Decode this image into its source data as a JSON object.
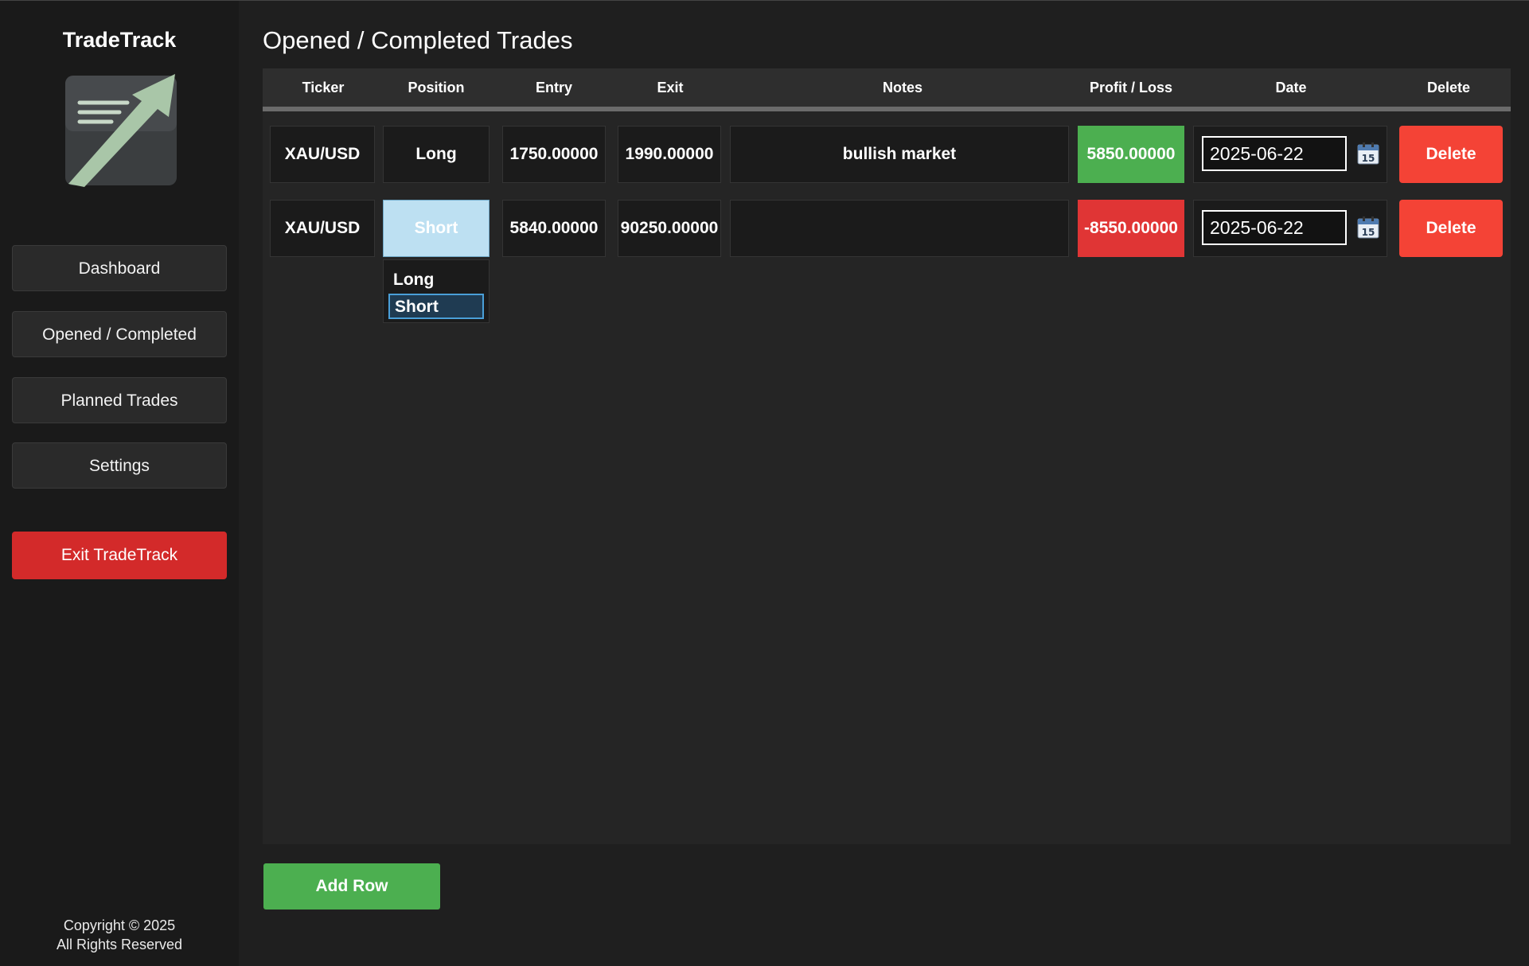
{
  "app": {
    "name": "TradeTrack"
  },
  "sidebar": {
    "items": [
      {
        "label": "Dashboard"
      },
      {
        "label": "Opened / Completed"
      },
      {
        "label": "Planned Trades"
      },
      {
        "label": "Settings"
      }
    ],
    "exit_label": "Exit TradeTrack",
    "copyright_line1": "Copyright © 2025",
    "copyright_line2": "All Rights Reserved"
  },
  "main": {
    "title": "Opened / Completed Trades",
    "columns": [
      "Ticker",
      "Position",
      "Entry",
      "Exit",
      "Notes",
      "Profit / Loss",
      "Date",
      "Delete"
    ],
    "rows": [
      {
        "ticker": "XAU/USD",
        "position": "Long",
        "entry": "1750.00000",
        "exit": "1990.00000",
        "notes": "bullish market",
        "pl": "5850.00000",
        "pl_status": "profit",
        "date": "2025-06-22",
        "delete_label": "Delete"
      },
      {
        "ticker": "XAU/USD",
        "position": "Short",
        "entry": "5840.00000",
        "exit": "90250.00000",
        "notes": "",
        "pl": "-8550.00000",
        "pl_status": "loss",
        "date": "2025-06-22",
        "delete_label": "Delete"
      }
    ],
    "position_dropdown": {
      "options": [
        "Long",
        "Short"
      ],
      "selected": "Short"
    },
    "add_row_label": "Add Row"
  },
  "colors": {
    "profit": "#4caf50",
    "loss": "#e03535",
    "delete": "#f44336",
    "exit_button": "#d32a2a"
  },
  "icons": {
    "logo": "trend-arrow-logo",
    "date_picker": "calendar-icon"
  }
}
